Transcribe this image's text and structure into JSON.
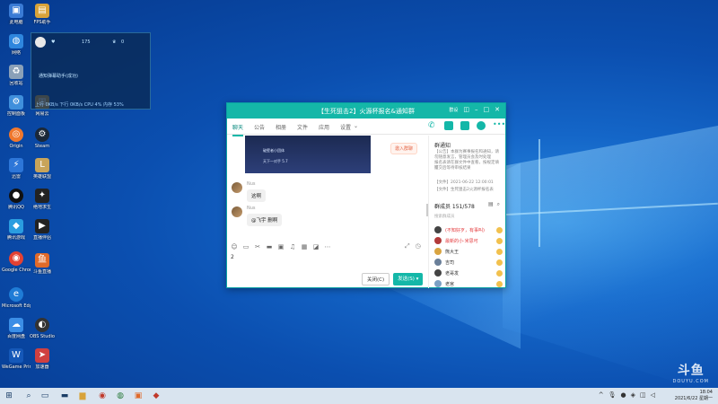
{
  "desktop_icons": [
    {
      "label": "此电脑",
      "icon": "computer-icon",
      "color": "#3a7bd5"
    },
    {
      "label": "网络",
      "icon": "network-icon",
      "color": "#2e86de"
    },
    {
      "label": "回收站",
      "icon": "recycle-bin-icon",
      "color": "#8aa0b8"
    },
    {
      "label": "控制面板",
      "icon": "control-panel-icon",
      "color": "#3f8fdc"
    },
    {
      "label": "Origin",
      "icon": "origin-icon",
      "color": "#f0782d"
    },
    {
      "label": "迅雷",
      "icon": "thunder-icon",
      "color": "#2d76d8"
    },
    {
      "label": "腾讯QQ",
      "icon": "qq-icon",
      "color": "#111111"
    },
    {
      "label": "腾讯游戏",
      "icon": "tencent-game-icon",
      "color": "#2a9de0"
    },
    {
      "label": "Google Chrome",
      "icon": "chrome-icon",
      "color": "#e34133"
    },
    {
      "label": "Microsoft Edge",
      "icon": "edge-icon",
      "color": "#1f7cd6"
    },
    {
      "label": "百度网盘",
      "icon": "baidu-netdisk-icon",
      "color": "#3b8ee6"
    },
    {
      "label": "WeGame Prime",
      "icon": "wegame-icon",
      "color": "#1558b8"
    },
    {
      "label": "FPS助手",
      "icon": "fps-helper-icon",
      "color": "#d8a33a"
    },
    {
      "label": "网易云",
      "icon": "netease-icon",
      "color": "#d8a33a"
    },
    {
      "label": "Steam",
      "icon": "steam-icon",
      "color": "#1b2838"
    },
    {
      "label": "英雄联盟",
      "icon": "lol-icon",
      "color": "#c8a45a"
    },
    {
      "label": "绝地求生",
      "icon": "pubg-icon",
      "color": "#222222"
    },
    {
      "label": "直播伴侣",
      "icon": "live-icon",
      "color": "#222222"
    },
    {
      "label": "斗鱼直播",
      "icon": "douyu-icon",
      "color": "#e06a2a"
    },
    {
      "label": "OBS Studio",
      "icon": "obs-icon",
      "color": "#333333"
    },
    {
      "label": "加速器",
      "icon": "accelerator-icon",
      "color": "#d04040"
    }
  ],
  "widget": {
    "stat1": "175",
    "stat2": "0",
    "line2": "通知弹幕助手(成功)",
    "footer": "上行 0KB/s  下行 0KB/s  CPU 4%  内存 53%"
  },
  "chat_window": {
    "title": "【生死狙击2】火源杯报名&通知群",
    "title_extra": "群设",
    "tabs": [
      "聊天",
      "公告",
      "相册",
      "文件",
      "应用",
      "设置"
    ],
    "invite_label": "邀入群聊",
    "shared_rows": [
      "破壁者小团体",
      "天下一对手 5.7"
    ],
    "messages": [
      {
        "sender": "Nus",
        "text": "这啊"
      },
      {
        "sender": "Nus",
        "text": "@飞宇 删啊"
      }
    ],
    "input_text": "2",
    "close_label": "关闭(C)",
    "send_label": "发送(S)",
    "sidebar": {
      "notice_heading": "群通知",
      "notice_lines": [
        "【公告】本群为赛事报名和通知，请",
        "勿随意发言，管理员会及时处理",
        "报名表请在群文件中查看，按规定填写",
        "提交后等待审核结果",
        "【文件】2021-06-22 12:00:01",
        "【文件】生死狙击2火源杯报名表"
      ],
      "members_label": "群成员 151/578",
      "search_placeholder": "搜索群成员",
      "members": [
        {
          "name": "(不知好歹，有事叫)",
          "red": true
        },
        {
          "name": "最新的小·米思可",
          "red": true
        },
        {
          "name": "熊大王",
          "red": false
        },
        {
          "name": "吉司",
          "red": false
        },
        {
          "name": "老哥发",
          "red": false
        },
        {
          "name": "老宫",
          "red": false
        },
        {
          "name": "Rune",
          "red": false
        }
      ]
    }
  },
  "taskbar": {
    "time": "18:04",
    "date": "2021/6/22 星期一"
  },
  "watermark": {
    "main": "斗鱼",
    "sub": "DOUYU.COM"
  }
}
